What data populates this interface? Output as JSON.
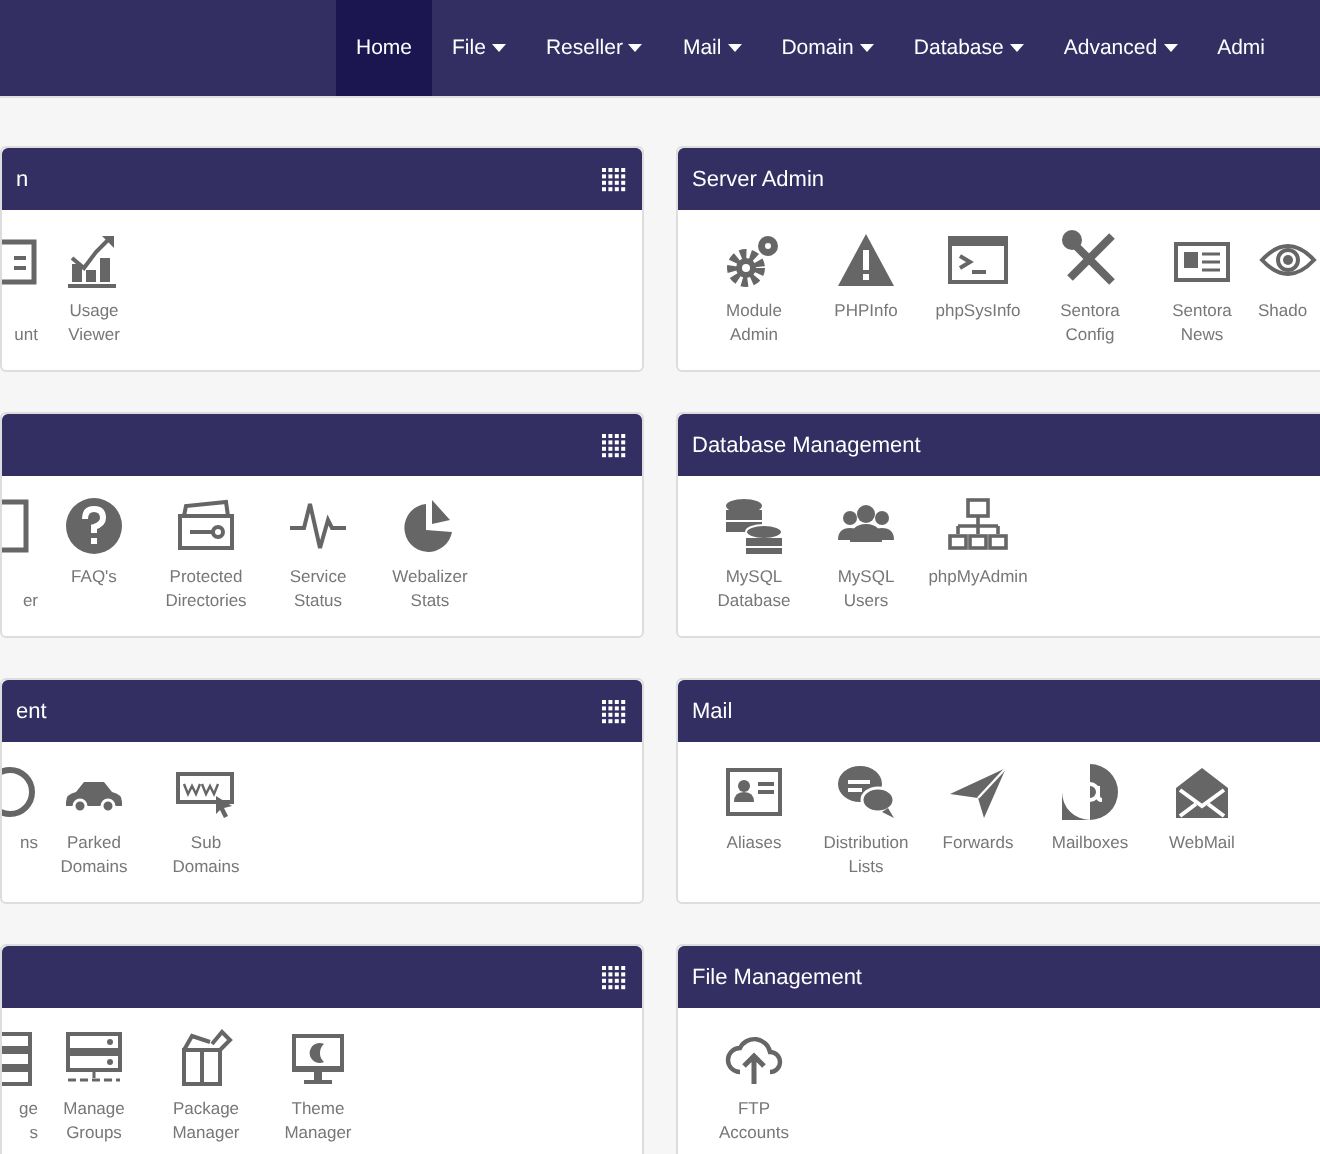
{
  "nav": {
    "items": [
      {
        "label": "Home",
        "selected": true,
        "caret": false
      },
      {
        "label": "File",
        "selected": false,
        "caret": true
      },
      {
        "label": "Reseller",
        "selected": false,
        "caret": true
      },
      {
        "label": "Mail",
        "selected": false,
        "caret": true
      },
      {
        "label": "Domain",
        "selected": false,
        "caret": true
      },
      {
        "label": "Database",
        "selected": false,
        "caret": true
      },
      {
        "label": "Advanced",
        "selected": false,
        "caret": true
      },
      {
        "label": "Admi",
        "selected": false,
        "caret": false
      }
    ]
  },
  "columns": [
    {
      "panels": [
        {
          "title": "n",
          "menu_icon": true,
          "items": [
            {
              "kind": "cut_left",
              "lines": [
                "unt"
              ],
              "first_line_hidden": true
            },
            {
              "kind": "full",
              "lines": [
                "Usage",
                "Viewer"
              ]
            }
          ]
        },
        {
          "menu_icon": true,
          "items": [
            {
              "kind": "cut_left",
              "lines": [
                "er"
              ],
              "first_line_hidden": true
            },
            {
              "kind": "full",
              "lines": [
                "FAQ's"
              ]
            },
            {
              "kind": "full",
              "lines": [
                "Protected",
                "Directories"
              ]
            },
            {
              "kind": "full",
              "lines": [
                "Service",
                "Status"
              ]
            },
            {
              "kind": "full",
              "lines": [
                "Webalizer",
                "Stats"
              ]
            }
          ]
        },
        {
          "title": "ent",
          "menu_icon": true,
          "items": [
            {
              "kind": "cut_left",
              "lines": [
                "ns"
              ],
              "first_line_hidden": false
            },
            {
              "kind": "full",
              "lines": [
                "Parked",
                "Domains"
              ]
            },
            {
              "kind": "full",
              "lines": [
                "Sub",
                "Domains"
              ]
            }
          ]
        },
        {
          "menu_icon": true,
          "items": [
            {
              "kind": "cut_left",
              "lines": [
                "ge",
                "s"
              ],
              "first_line_hidden": false
            },
            {
              "kind": "full",
              "lines": [
                "Manage",
                "Groups"
              ]
            },
            {
              "kind": "full",
              "lines": [
                "Package",
                "Manager"
              ]
            },
            {
              "kind": "full",
              "lines": [
                "Theme",
                "Manager"
              ]
            }
          ]
        }
      ]
    },
    {
      "panels": [
        {
          "title": "Server Admin",
          "menu_icon": false,
          "items": [
            {
              "kind": "full",
              "lines": [
                "Module",
                "Admin"
              ]
            },
            {
              "kind": "full",
              "lines": [
                "PHPInfo"
              ]
            },
            {
              "kind": "full",
              "lines": [
                "phpSysInfo"
              ]
            },
            {
              "kind": "full",
              "lines": [
                "Sentora",
                "Config"
              ]
            },
            {
              "kind": "full",
              "lines": [
                "Sentora",
                "News"
              ]
            },
            {
              "kind": "cut_right",
              "lines": [
                "Shado"
              ]
            }
          ]
        },
        {
          "title": "Database Management",
          "menu_icon": false,
          "items": [
            {
              "kind": "full",
              "lines": [
                "MySQL",
                "Database"
              ]
            },
            {
              "kind": "full",
              "lines": [
                "MySQL",
                "Users"
              ]
            },
            {
              "kind": "full",
              "lines": [
                "phpMyAdmin"
              ]
            }
          ]
        },
        {
          "title": "Mail",
          "menu_icon": false,
          "items": [
            {
              "kind": "full",
              "lines": [
                "Aliases"
              ]
            },
            {
              "kind": "full",
              "lines": [
                "Distribution",
                "Lists"
              ]
            },
            {
              "kind": "full",
              "lines": [
                "Forwards"
              ]
            },
            {
              "kind": "full",
              "lines": [
                "Mailboxes"
              ]
            },
            {
              "kind": "full",
              "lines": [
                "WebMail"
              ]
            }
          ]
        },
        {
          "title": "File Management",
          "menu_icon": false,
          "items": [
            {
              "kind": "full",
              "lines": [
                "FTP",
                "Accounts"
              ]
            }
          ]
        }
      ]
    }
  ]
}
